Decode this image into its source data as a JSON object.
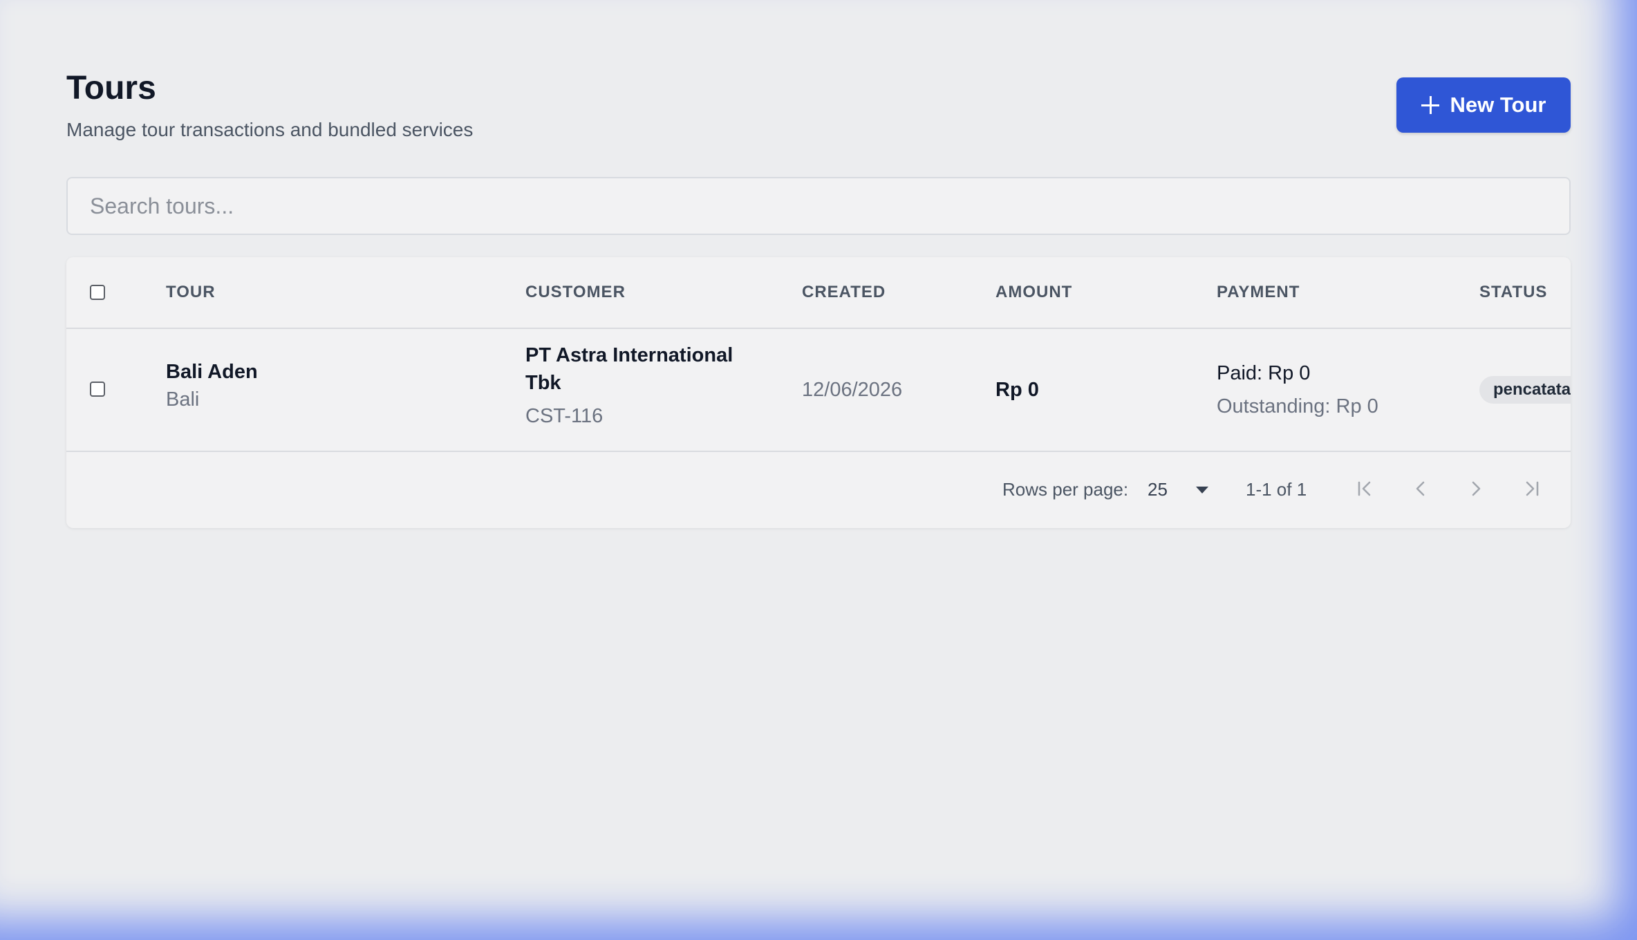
{
  "header": {
    "title": "Tours",
    "subtitle": "Manage tour transactions and bundled services",
    "new_button_label": "New Tour"
  },
  "search": {
    "placeholder": "Search tours..."
  },
  "table": {
    "columns": [
      "TOUR",
      "CUSTOMER",
      "CREATED",
      "AMOUNT",
      "PAYMENT",
      "STATUS"
    ],
    "rows": [
      {
        "tour_name": "Bali Aden",
        "tour_destination": "Bali",
        "customer_name_line1": "PT Astra International",
        "customer_name_line2": "Tbk",
        "customer_code": "CST-116",
        "created": "12/06/2026",
        "amount": "Rp 0",
        "paid": "Paid: Rp 0",
        "outstanding": "Outstanding: Rp 0",
        "status": "pencatatan"
      }
    ]
  },
  "pagination": {
    "rows_per_page_label": "Rows per page:",
    "rows_per_page_value": "25",
    "range": "1-1 of 1"
  },
  "colors": {
    "primary": "#2f56d6",
    "background": "#ecedef",
    "card": "#f2f2f3"
  },
  "icons": {
    "new_button": "plus-icon",
    "first_page": "first-page-icon",
    "prev_page": "chevron-left-icon",
    "next_page": "chevron-right-icon",
    "last_page": "last-page-icon",
    "dropdown": "caret-down-icon"
  }
}
